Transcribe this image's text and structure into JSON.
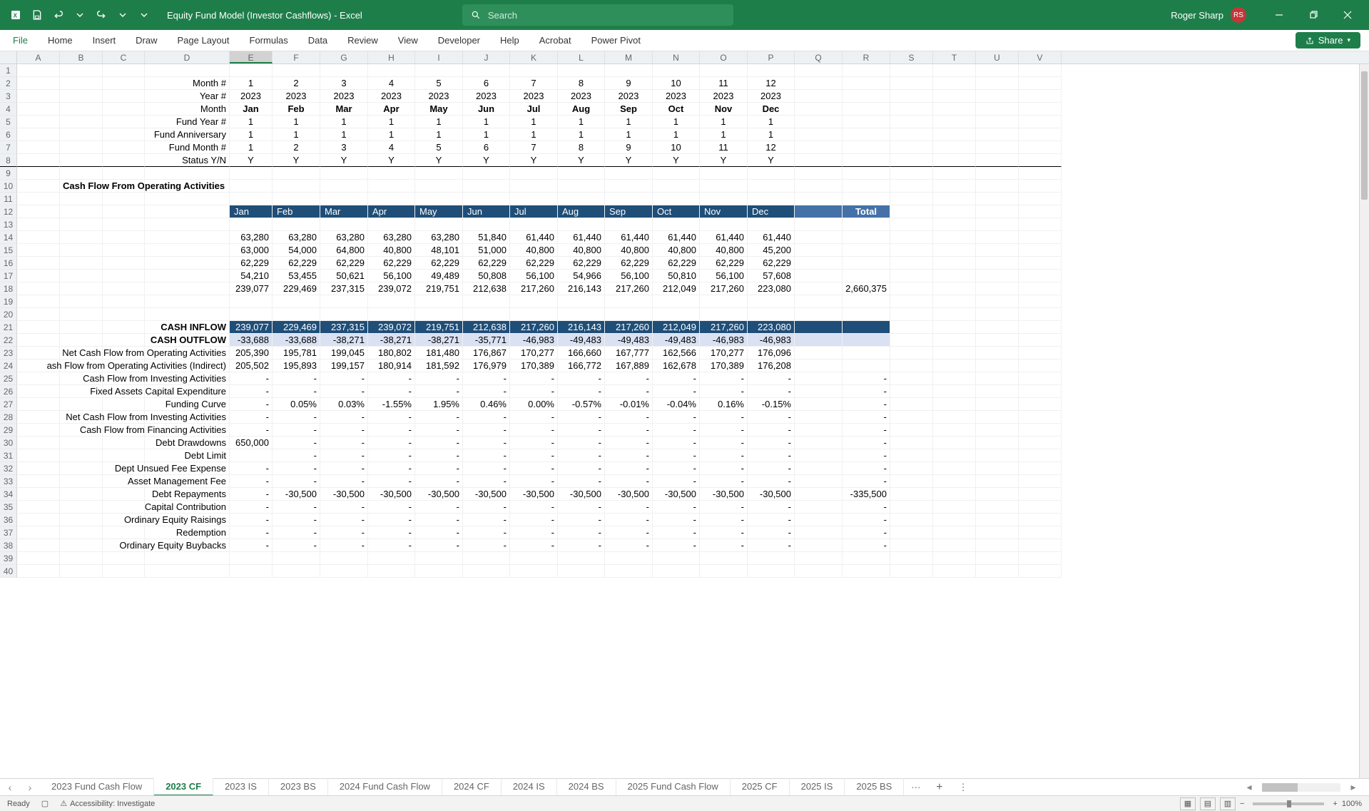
{
  "app": {
    "doc_title": "Equity Fund Model (Investor Cashflows)  -  Excel",
    "search_placeholder": "Search",
    "user_name": "Roger Sharp",
    "user_initials": "RS"
  },
  "ribbon": {
    "tabs": [
      "File",
      "Home",
      "Insert",
      "Draw",
      "Page Layout",
      "Formulas",
      "Data",
      "Review",
      "View",
      "Developer",
      "Help",
      "Acrobat",
      "Power Pivot"
    ],
    "share_label": "Share"
  },
  "columns": [
    "A",
    "B",
    "C",
    "D",
    "E",
    "F",
    "G",
    "H",
    "I",
    "J",
    "K",
    "L",
    "M",
    "N",
    "O",
    "P",
    "Q",
    "R",
    "S",
    "T",
    "U",
    "V"
  ],
  "col_widths": {
    "A": 60,
    "B": 60,
    "C": 59,
    "D": 119,
    "E": 60,
    "F": 67,
    "G": 67,
    "H": 66,
    "I": 67,
    "J": 66,
    "K": 67,
    "L": 66,
    "M": 67,
    "N": 66,
    "O": 67,
    "P": 66,
    "Q": 67,
    "R": 67,
    "S": 60,
    "T": 60,
    "U": 60,
    "V": 60
  },
  "selected_col": "E",
  "header_rows": {
    "month_num_label": "Month #",
    "year_num_label": "Year #",
    "month_label": "Month",
    "fund_year_label": "Fund Year #",
    "fund_anniv_label": "Fund Anniversary",
    "fund_month_label": "Fund Month #",
    "status_label": "Status Y/N",
    "month_nums": [
      "1",
      "2",
      "3",
      "4",
      "5",
      "6",
      "7",
      "8",
      "9",
      "10",
      "11",
      "12"
    ],
    "years": [
      "2023",
      "2023",
      "2023",
      "2023",
      "2023",
      "2023",
      "2023",
      "2023",
      "2023",
      "2023",
      "2023",
      "2023"
    ],
    "months": [
      "Jan",
      "Feb",
      "Mar",
      "Apr",
      "May",
      "Jun",
      "Jul",
      "Aug",
      "Sep",
      "Oct",
      "Nov",
      "Dec"
    ],
    "fund_years": [
      "1",
      "1",
      "1",
      "1",
      "1",
      "1",
      "1",
      "1",
      "1",
      "1",
      "1",
      "1"
    ],
    "fund_annivs": [
      "1",
      "1",
      "1",
      "1",
      "1",
      "1",
      "1",
      "1",
      "1",
      "1",
      "1",
      "1"
    ],
    "fund_months": [
      "1",
      "2",
      "3",
      "4",
      "5",
      "6",
      "7",
      "8",
      "9",
      "10",
      "11",
      "12"
    ],
    "statuses": [
      "Y",
      "Y",
      "Y",
      "Y",
      "Y",
      "Y",
      "Y",
      "Y",
      "Y",
      "Y",
      "Y",
      "Y"
    ]
  },
  "section_title": "Cash Flow From Operating Activities",
  "month_header": [
    "Jan",
    "Feb",
    "Mar",
    "Apr",
    "May",
    "Jun",
    "Jul",
    "Aug",
    "Sep",
    "Oct",
    "Nov",
    "Dec",
    "Total"
  ],
  "data_rows": {
    "r14": [
      "63,280",
      "63,280",
      "63,280",
      "63,280",
      "63,280",
      "51,840",
      "61,440",
      "61,440",
      "61,440",
      "61,440",
      "61,440",
      "61,440",
      ""
    ],
    "r15": [
      "63,000",
      "54,000",
      "64,800",
      "40,800",
      "48,101",
      "51,000",
      "40,800",
      "40,800",
      "40,800",
      "40,800",
      "40,800",
      "45,200",
      ""
    ],
    "r16": [
      "62,229",
      "62,229",
      "62,229",
      "62,229",
      "62,229",
      "62,229",
      "62,229",
      "62,229",
      "62,229",
      "62,229",
      "62,229",
      "62,229",
      ""
    ],
    "r17": [
      "54,210",
      "53,455",
      "50,621",
      "56,100",
      "49,489",
      "50,808",
      "56,100",
      "54,966",
      "56,100",
      "50,810",
      "56,100",
      "57,608",
      ""
    ],
    "r18": [
      "239,077",
      "229,469",
      "237,315",
      "239,072",
      "219,751",
      "212,638",
      "217,260",
      "216,143",
      "217,260",
      "212,049",
      "217,260",
      "223,080",
      "2,660,375"
    ]
  },
  "labels": {
    "cash_inflow": "CASH INFLOW",
    "cash_outflow": "CASH OUTFLOW",
    "net_cf_ops": "Net Cash Flow from Operating Activities",
    "cf_ops_indirect": "ash Flow from Operating Activities (Indirect)",
    "cf_investing": "Cash Flow from Investing Activities",
    "capex": "Fixed Assets Capital Expenditure",
    "funding_curve": "Funding Curve",
    "net_cf_inv": "Net Cash Flow from Investing Activities",
    "cf_financing": "Cash Flow from Financing Activities",
    "debt_drawdowns": "Debt Drawdowns",
    "debt_limit": "Debt Limit",
    "unused_fee": "Dept Unsued Fee Expense",
    "amf": "Asset Management Fee",
    "debt_repay": "Debt Repayments",
    "cap_contrib": "Capital Contribution",
    "equity_raise": "Ordinary Equity Raisings",
    "redemption": "Redemption",
    "buybacks": "Ordinary Equity Buybacks"
  },
  "cashflow_rows": {
    "inflow": [
      "239,077",
      "229,469",
      "237,315",
      "239,072",
      "219,751",
      "212,638",
      "217,260",
      "216,143",
      "217,260",
      "212,049",
      "217,260",
      "223,080",
      ""
    ],
    "outflow": [
      "-33,688",
      "-33,688",
      "-38,271",
      "-38,271",
      "-38,271",
      "-35,771",
      "-46,983",
      "-49,483",
      "-49,483",
      "-49,483",
      "-46,983",
      "-46,983",
      ""
    ],
    "r23": [
      "205,390",
      "195,781",
      "199,045",
      "180,802",
      "181,480",
      "176,867",
      "170,277",
      "166,660",
      "167,777",
      "162,566",
      "170,277",
      "176,096",
      ""
    ],
    "r24": [
      "205,502",
      "195,893",
      "199,157",
      "180,914",
      "181,592",
      "176,979",
      "170,389",
      "166,772",
      "167,889",
      "162,678",
      "170,389",
      "176,208",
      ""
    ],
    "r25": [
      "-",
      "-",
      "-",
      "-",
      "-",
      "-",
      "-",
      "-",
      "-",
      "-",
      "-",
      "-",
      "-"
    ],
    "r26": [
      "-",
      "-",
      "-",
      "-",
      "-",
      "-",
      "-",
      "-",
      "-",
      "-",
      "-",
      "-",
      "-"
    ],
    "r27": [
      "-",
      "0.05%",
      "0.03%",
      "-1.55%",
      "1.95%",
      "0.46%",
      "0.00%",
      "-0.57%",
      "-0.01%",
      "-0.04%",
      "0.16%",
      "-0.15%",
      "-"
    ],
    "r28": [
      "-",
      "-",
      "-",
      "-",
      "-",
      "-",
      "-",
      "-",
      "-",
      "-",
      "-",
      "-",
      "-"
    ],
    "r29": [
      "-",
      "-",
      "-",
      "-",
      "-",
      "-",
      "-",
      "-",
      "-",
      "-",
      "-",
      "-",
      "-"
    ],
    "r30": [
      "650,000",
      "-",
      "-",
      "-",
      "-",
      "-",
      "-",
      "-",
      "-",
      "-",
      "-",
      "-",
      "-"
    ],
    "r31": [
      "",
      "-",
      "-",
      "-",
      "-",
      "-",
      "-",
      "-",
      "-",
      "-",
      "-",
      "-",
      "-"
    ],
    "r32": [
      "-",
      "-",
      "-",
      "-",
      "-",
      "-",
      "-",
      "-",
      "-",
      "-",
      "-",
      "-",
      "-"
    ],
    "r33": [
      "-",
      "-",
      "-",
      "-",
      "-",
      "-",
      "-",
      "-",
      "-",
      "-",
      "-",
      "-",
      "-"
    ],
    "r34": [
      "-",
      "-30,500",
      "-30,500",
      "-30,500",
      "-30,500",
      "-30,500",
      "-30,500",
      "-30,500",
      "-30,500",
      "-30,500",
      "-30,500",
      "-30,500",
      "-335,500"
    ],
    "r35": [
      "-",
      "-",
      "-",
      "-",
      "-",
      "-",
      "-",
      "-",
      "-",
      "-",
      "-",
      "-",
      "-"
    ],
    "r36": [
      "-",
      "-",
      "-",
      "-",
      "-",
      "-",
      "-",
      "-",
      "-",
      "-",
      "-",
      "-",
      "-"
    ],
    "r37": [
      "-",
      "-",
      "-",
      "-",
      "-",
      "-",
      "-",
      "-",
      "-",
      "-",
      "-",
      "-",
      "-"
    ],
    "r38": [
      "-",
      "-",
      "-",
      "-",
      "-",
      "-",
      "-",
      "-",
      "-",
      "-",
      "-",
      "-",
      "-"
    ]
  },
  "sheet_tabs": [
    "2023 Fund Cash Flow",
    "2023 CF",
    "2023 IS",
    "2023 BS",
    "2024 Fund Cash Flow",
    "2024 CF",
    "2024 IS",
    "2024 BS",
    "2025 Fund Cash Flow",
    "2025 CF",
    "2025 IS",
    "2025 BS"
  ],
  "active_sheet": "2023 CF",
  "status": {
    "ready": "Ready",
    "accessibility": "Accessibility: Investigate",
    "zoom": "100%"
  }
}
